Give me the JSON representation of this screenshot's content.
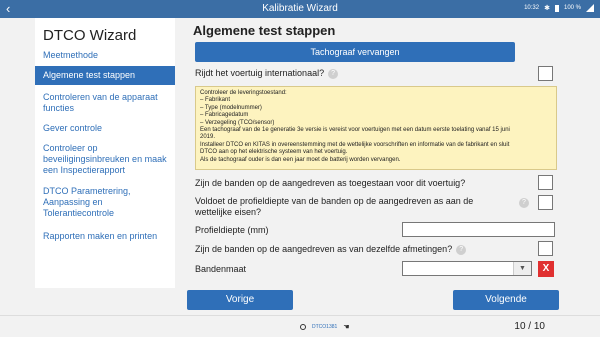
{
  "topbar": {
    "back_icon": "‹",
    "title": "Kalibratie Wizard",
    "time": "10:32",
    "bluetooth": "✱",
    "battery_pct": "100 %"
  },
  "sidebar": {
    "title": "DTCO Wizard",
    "items": [
      {
        "label": "Meetmethode",
        "active": false
      },
      {
        "label": "Algemene test stappen",
        "active": true
      },
      {
        "label": "Controleren van de apparaat functies",
        "active": false
      },
      {
        "label": "Gever controle",
        "active": false
      },
      {
        "label": "Controleer op beveiligingsinbreuken en maak een Inspectierapport",
        "active": false
      },
      {
        "label": "DTCO Parametrering, Aanpassing en Tolerantiecontrole",
        "active": false
      },
      {
        "label": "Rapporten maken en printen",
        "active": false
      }
    ]
  },
  "main": {
    "title": "Algemene test stappen",
    "replace_button": "Tachograaf vervangen",
    "q_international": "Rijdt het voertuig internationaal?",
    "help_icon": "?",
    "info_lines": [
      "Controleer de leveringstoestand:",
      "– Fabrikant",
      "– Type (modelnummer)",
      "– Fabricagedatum",
      "– Verzegeling (TCO/sensor)",
      "Een tachograaf van de 1e generatie 3e versie is vereist voor voertuigen met een datum eerste toelating vanaf 15 juni",
      "2019.",
      "Installeer DTCO en KITAS in overeenstemming met de wettelijke voorschriften en informatie van de fabrikant en sluit",
      "DTCO aan op het elektrische systeem van het voertuig.",
      "Als de tachograaf ouder is dan een jaar moet de batterij worden vervangen."
    ],
    "q_tires_allowed": "Zijn de banden op de aangedreven as toegestaan voor dit voertuig?",
    "q_tread_depth": "Voldoet de profieldiepte van de banden op de aangedreven as aan de wettelijke eisen?",
    "profile_depth_label": "Profieldiepte (mm)",
    "profile_depth_value": "",
    "q_same_size": "Zijn de banden op de aangedreven as van dezelfde afmetingen?",
    "tire_size_label": "Bandenmaat",
    "tire_size_value": "",
    "dropdown_icon": "▼",
    "clear_icon": "X"
  },
  "nav": {
    "prev": "Vorige",
    "next": "Volgende"
  },
  "footer": {
    "device": "DTCO1381",
    "hand_icon": "☚",
    "pages": "10 / 10"
  }
}
